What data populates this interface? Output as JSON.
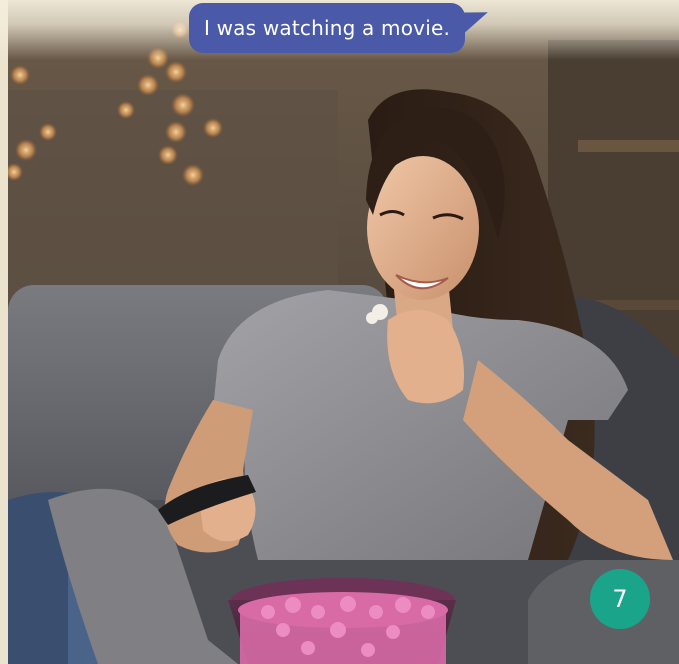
{
  "speech_bubble": {
    "text": "I was watching a movie."
  },
  "page_number": "7",
  "colors": {
    "bubble": "#4a5aa8",
    "badge": "#1aa58b",
    "sofa": "#6c6d72",
    "shirt": "#8f8f93",
    "popcorn": "#d86aa6"
  }
}
